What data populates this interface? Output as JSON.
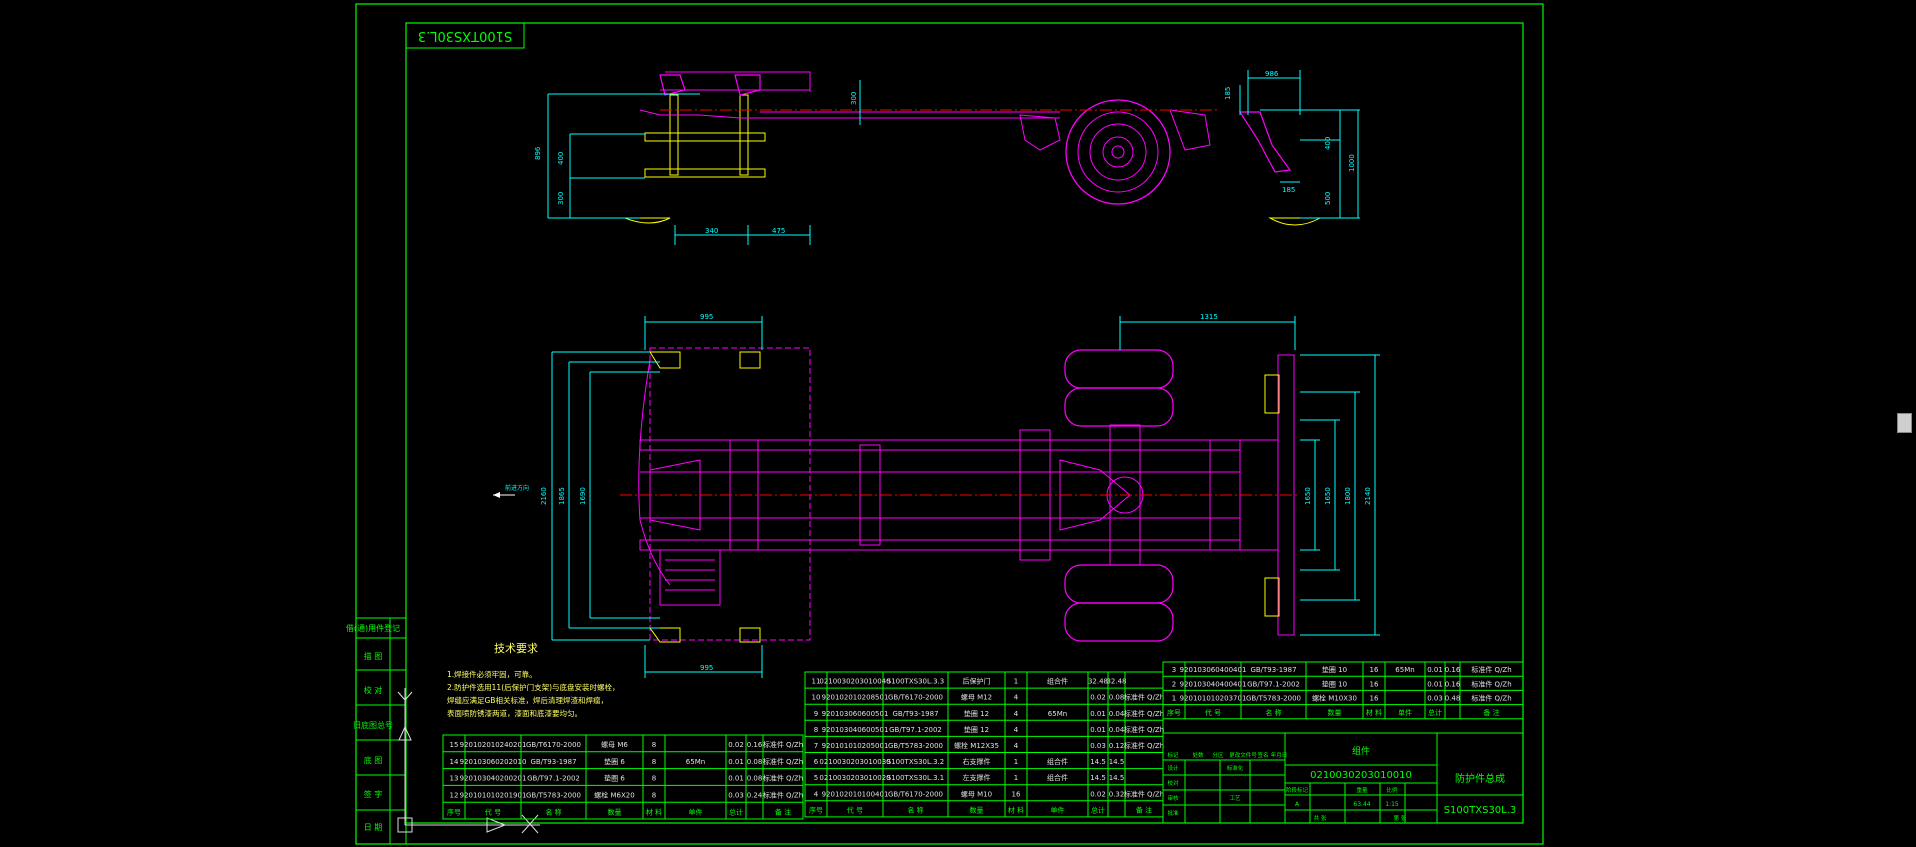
{
  "drawing": {
    "mirrored_code": "S100TXS30L.3",
    "notes_title": "技术要求",
    "notes": [
      "1.焊接件必须牢固，可靠。",
      "2.防护件选用11(后保护门支架)与底盘安装时螺栓，",
      "  焊缝应满足GB相关标准，焊后清理焊渣和焊瘤，",
      "  表面喷防锈漆两道，漆面和底漆要均匀。"
    ],
    "side_label": "前进方向"
  },
  "side_stamp": [
    "借(通)用件登记",
    "描 图",
    "校 对",
    "旧底图总号",
    "底 图",
    "签 字",
    "日 期"
  ],
  "dimensions": {
    "top_view": [
      "896",
      "400",
      "300",
      "300",
      "340",
      "475",
      "185",
      "986",
      "400",
      "1000",
      "500",
      "185"
    ],
    "plan_view": [
      "995",
      "1315",
      "2160",
      "1865",
      "1690",
      "1650",
      "1650",
      "1800",
      "2140",
      "995"
    ]
  },
  "bom_left": {
    "rows": [
      {
        "seq": "15",
        "code": "920102010240201",
        "std": "GB/T6170-2000",
        "name": "螺母 M6",
        "qty": "8",
        "mat": "",
        "w1": "0.02",
        "w2": "0.16",
        "note": "标准件 Q/Zh"
      },
      {
        "seq": "14",
        "code": "920103060202010",
        "std": "GB/T93-1987",
        "name": "垫圈 6",
        "qty": "8",
        "mat": "65Mn",
        "w1": "0.01",
        "w2": "0.08",
        "note": "标准件 Q/Zh"
      },
      {
        "seq": "13",
        "code": "920103040200201",
        "std": "GB/T97.1-2002",
        "name": "垫圈 6",
        "qty": "8",
        "mat": "",
        "w1": "0.01",
        "w2": "0.08",
        "note": "标准件 Q/Zh"
      },
      {
        "seq": "12",
        "code": "920101010201901",
        "std": "GB/T5783-2000",
        "name": "螺栓 M6X20",
        "qty": "8",
        "mat": "",
        "w1": "0.03",
        "w2": "0.24",
        "note": "标准件 Q/Zh"
      }
    ],
    "header": [
      "序号",
      "代  号",
      "名  称",
      "数量",
      "材  料",
      "单件",
      "总计",
      "备  注"
    ]
  },
  "bom_middle": {
    "rows": [
      {
        "seq": "11",
        "code": "0210030203010040",
        "std": "S100TXS30L.3.3",
        "name": "后保护门",
        "qty": "1",
        "mat": "组合件",
        "w1": "32.48",
        "w2": "32.48",
        "note": ""
      },
      {
        "seq": "10",
        "code": "920102010208501",
        "std": "GB/T6170-2000",
        "name": "螺母 M12",
        "qty": "4",
        "mat": "",
        "w1": "0.02",
        "w2": "0.08",
        "note": "标准件 Q/Zh"
      },
      {
        "seq": "9",
        "code": "920103060600501",
        "std": "GB/T93-1987",
        "name": "垫圈 12",
        "qty": "4",
        "mat": "65Mn",
        "w1": "0.01",
        "w2": "0.04",
        "note": "标准件 Q/Zh"
      },
      {
        "seq": "8",
        "code": "920103040600501",
        "std": "GB/T97.1-2002",
        "name": "垫圈 12",
        "qty": "4",
        "mat": "",
        "w1": "0.01",
        "w2": "0.04",
        "note": "标准件 Q/Zh"
      },
      {
        "seq": "7",
        "code": "920101010205001",
        "std": "GB/T5783-2000",
        "name": "螺栓 M12X35",
        "qty": "4",
        "mat": "",
        "w1": "0.03",
        "w2": "0.12",
        "note": "标准件 Q/Zh"
      },
      {
        "seq": "6",
        "code": "0210030203010030",
        "std": "S100TXS30L.3.2",
        "name": "右支撑件",
        "qty": "1",
        "mat": "组合件",
        "w1": "14.5",
        "w2": "14.5",
        "note": ""
      },
      {
        "seq": "5",
        "code": "0210030203010020",
        "std": "S100TXS30L.3.1",
        "name": "左支撑件",
        "qty": "1",
        "mat": "组合件",
        "w1": "14.5",
        "w2": "14.5",
        "note": ""
      },
      {
        "seq": "4",
        "code": "920102010100401",
        "std": "GB/T6170-2000",
        "name": "螺母 M10",
        "qty": "16",
        "mat": "",
        "w1": "0.02",
        "w2": "0.32",
        "note": "标准件 Q/Zh"
      }
    ],
    "header": [
      "序号",
      "代  号",
      "名  称",
      "数量",
      "材  料",
      "单件",
      "总计",
      "备  注"
    ]
  },
  "bom_right": {
    "rows": [
      {
        "seq": "3",
        "code": "920103060400401",
        "std": "GB/T93-1987",
        "name": "垫圈 10",
        "qty": "16",
        "mat": "65Mn",
        "w1": "0.01",
        "w2": "0.16",
        "note": "标准件 Q/Zh"
      },
      {
        "seq": "2",
        "code": "920103040400401",
        "std": "GB/T97.1-2002",
        "name": "垫圈 10",
        "qty": "16",
        "mat": "",
        "w1": "0.01",
        "w2": "0.16",
        "note": "标准件 Q/Zh"
      },
      {
        "seq": "1",
        "code": "920101010203701",
        "std": "GB/T5783-2000",
        "name": "螺栓 M10X30",
        "qty": "16",
        "mat": "",
        "w1": "0.03",
        "w2": "0.48",
        "note": "标准件 Q/Zh"
      }
    ],
    "header": [
      "序号",
      "代  号",
      "名  称",
      "数量",
      "材  料",
      "单件",
      "总计",
      "备  注"
    ]
  },
  "title_block": {
    "material_label": "组件",
    "drawing_no": "0210030203010010",
    "name": "防护件总成",
    "code": "S100TXS30L.3",
    "scale": "1:15",
    "weight": "63.44",
    "stage": "A",
    "labels": [
      "标记",
      "处数",
      "分区",
      "更改文件号",
      "签名",
      "年月日",
      "设计",
      "标准化",
      "校对",
      "审核",
      "工艺",
      "批准",
      "阶段标记",
      "重量",
      "比例",
      "共 张",
      "第 张"
    ]
  }
}
